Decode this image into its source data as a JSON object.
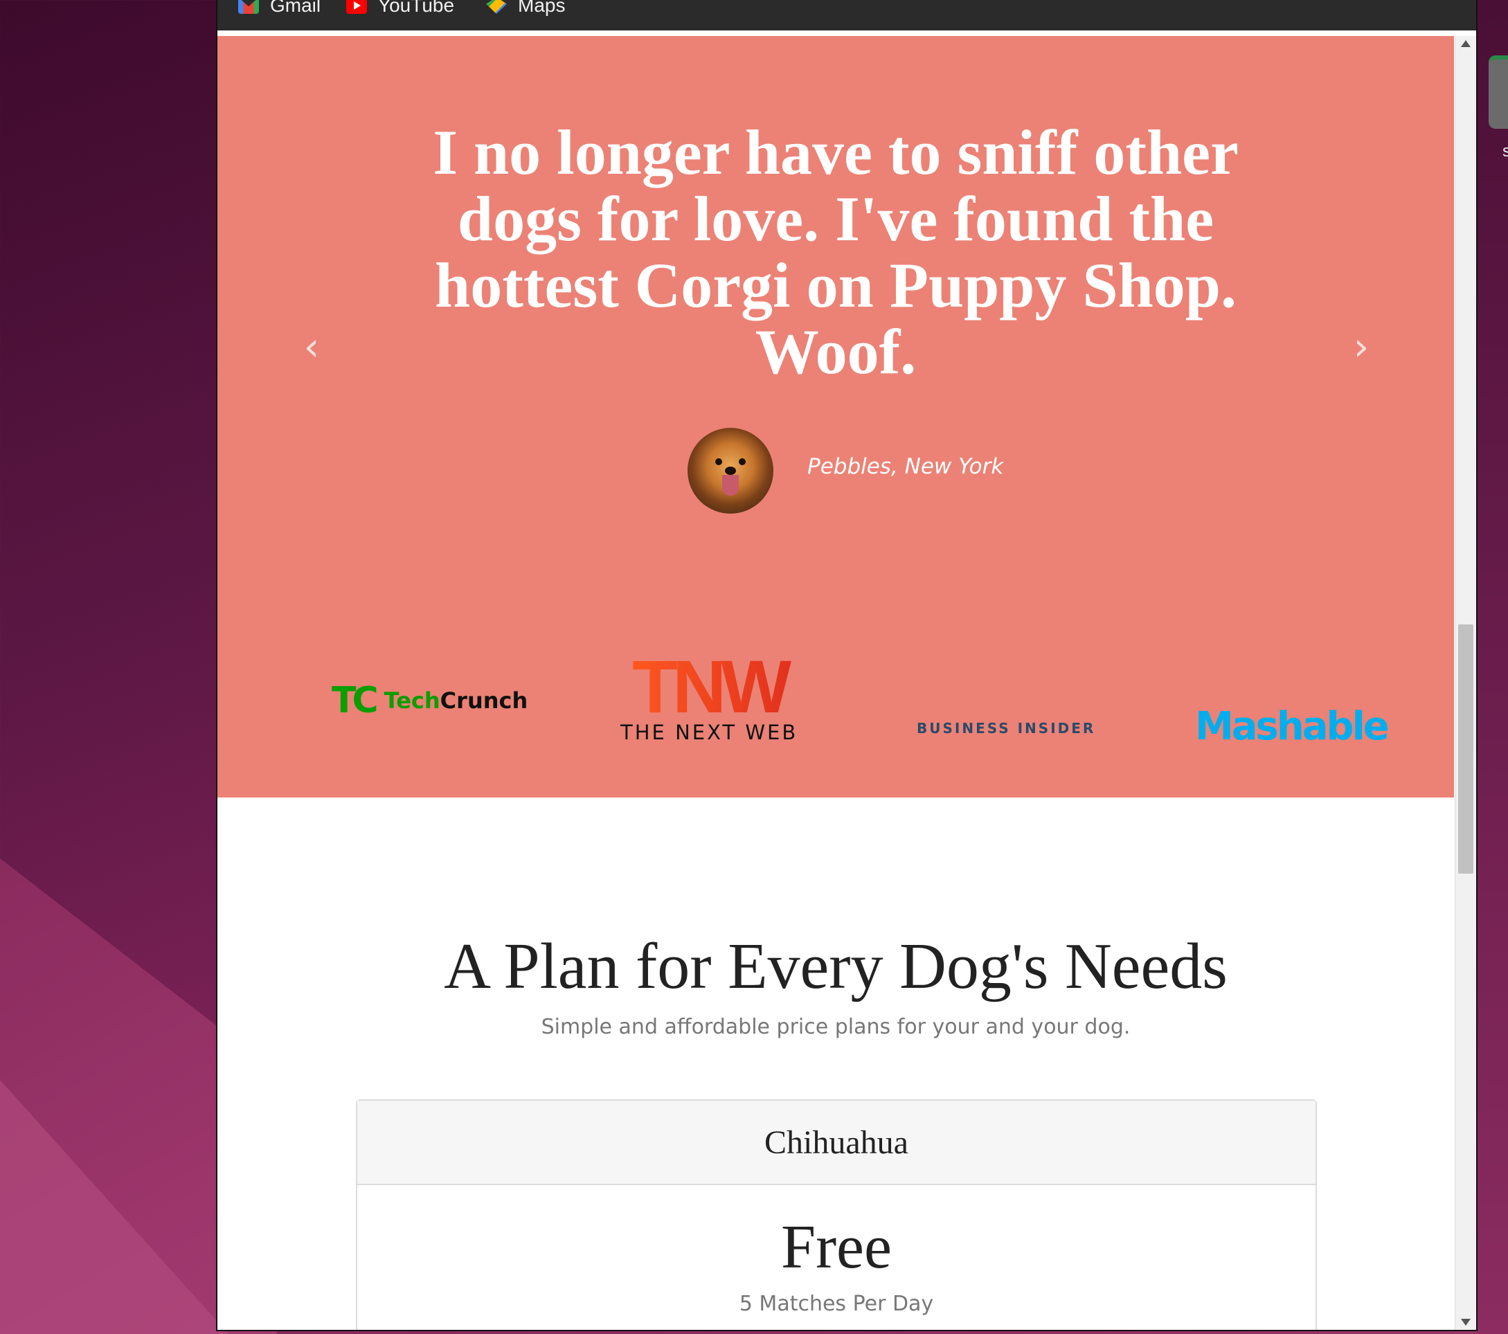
{
  "bookmarks": [
    {
      "label": "Gmail",
      "icon": "gmail-icon"
    },
    {
      "label": "YouTube",
      "icon": "youtube-icon"
    },
    {
      "label": "Maps",
      "icon": "maps-icon"
    }
  ],
  "testimonial": {
    "quote": "I no longer have to sniff other dogs for love. I've found the hottest Corgi on Puppy Shop. Woof.",
    "author": "Pebbles, New York",
    "prev_icon": "‹",
    "next_icon": "›",
    "background": "#eb8275"
  },
  "press": {
    "techcrunch": {
      "mark": "TC",
      "name_part1": "Tech",
      "name_part2": "Crunch"
    },
    "tnw": {
      "mark": "TNW",
      "sub": "THE NEXT WEB"
    },
    "business_insider": "BUSINESS INSIDER",
    "mashable": "Mashable"
  },
  "pricing": {
    "title": "A Plan for Every Dog's Needs",
    "subtitle": "Simple and affordable price plans for your and your dog.",
    "plans": [
      {
        "name": "Chihuahua",
        "price": "Free",
        "feature": "5 Matches Per Day"
      }
    ]
  },
  "desktop": {
    "dock_char": "s"
  }
}
